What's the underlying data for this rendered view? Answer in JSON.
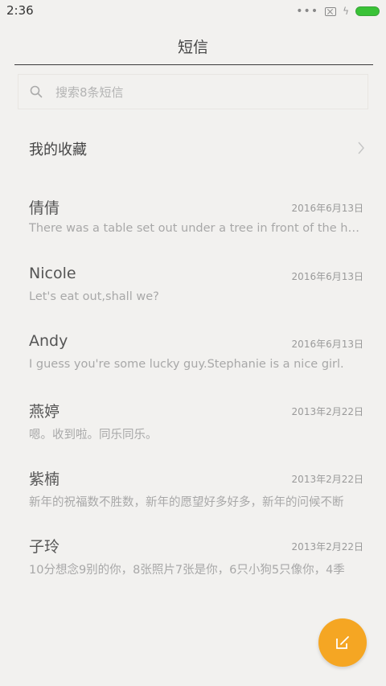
{
  "status_bar": {
    "time": "2:36"
  },
  "header": {
    "title": "短信"
  },
  "search": {
    "placeholder": "搜索8条短信"
  },
  "favorites": {
    "label": "我的收藏"
  },
  "conversations": [
    {
      "name": "倩倩",
      "date": "2016年6月13日",
      "preview": "There was a table set out under a tree in front of the house"
    },
    {
      "name": "Nicole",
      "date": "2016年6月13日",
      "preview": "Let's eat out,shall we?"
    },
    {
      "name": "Andy",
      "date": "2016年6月13日",
      "preview": "I guess you're some lucky guy.Stephanie is a nice girl."
    },
    {
      "name": "燕婷",
      "date": "2013年2月22日",
      "preview": "嗯。收到啦。同乐同乐。"
    },
    {
      "name": "紫楠",
      "date": "2013年2月22日",
      "preview": "新年的祝福数不胜数，新年的愿望好多好多，新年的问候不断"
    },
    {
      "name": "子玲",
      "date": "2013年2月22日",
      "preview": "10分想念9别的你，8张照片7张是你，6只小狗5只像你，4季"
    }
  ],
  "icons": {
    "search": "search-icon",
    "chevron": "chevron-right-icon",
    "compose": "compose-icon",
    "battery": "battery-icon",
    "sim": "no-sim-icon",
    "charging": "charging-icon"
  },
  "colors": {
    "background": "#f2f1ef",
    "accent": "#f5a623",
    "battery": "#39c236"
  }
}
